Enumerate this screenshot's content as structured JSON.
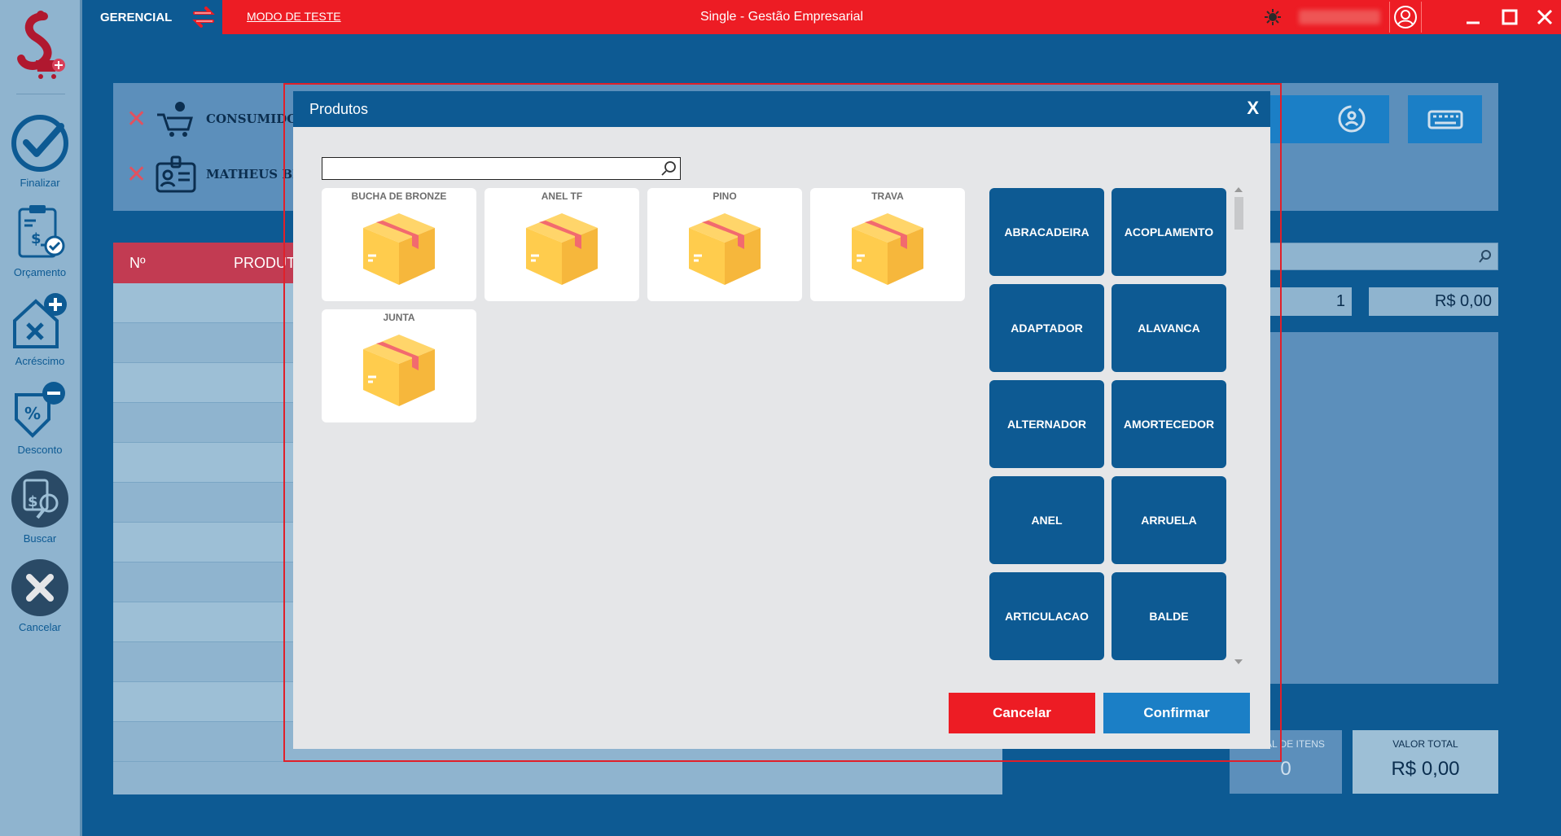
{
  "topbar": {
    "gerencial": "GERENCIAL",
    "modo_teste": "MODO DE TESTE",
    "title": "Single - Gestão Empresarial"
  },
  "sidebar": {
    "items": [
      {
        "label": "Finalizar",
        "icon": "check-circle-icon"
      },
      {
        "label": "Orçamento",
        "icon": "clipboard-money-icon"
      },
      {
        "label": "Acréscimo",
        "icon": "house-plus-icon"
      },
      {
        "label": "Desconto",
        "icon": "tag-minus-icon"
      },
      {
        "label": "Buscar",
        "icon": "calculator-search-icon"
      },
      {
        "label": "Cancelar",
        "icon": "x-circle-icon"
      }
    ]
  },
  "main": {
    "customer": "CONSUMIDOR",
    "seller": "MATHEUS BR",
    "table_headers": {
      "num": "Nº",
      "product": "PRODUT"
    },
    "quantity": "1",
    "price": "R$ 0,00",
    "total_items_label": "TOTAL DE ITENS",
    "total_items_value": "0",
    "total_value_label": "VALOR TOTAL",
    "total_value": "R$ 0,00"
  },
  "modal": {
    "title": "Produtos",
    "close": "X",
    "search_placeholder": "",
    "products": [
      {
        "name": "BUCHA DE BRONZE"
      },
      {
        "name": "ANEL TF"
      },
      {
        "name": "PINO"
      },
      {
        "name": "TRAVA"
      },
      {
        "name": "JUNTA"
      }
    ],
    "categories": [
      "ABRACADEIRA",
      "ACOPLAMENTO",
      "ADAPTADOR",
      "ALAVANCA",
      "ALTERNADOR",
      "AMORTECEDOR",
      "ANEL",
      "ARRUELA",
      "ARTICULACAO",
      "BALDE"
    ],
    "cancel": "Cancelar",
    "confirm": "Confirmar"
  },
  "colors": {
    "brand_blue": "#0d5a93",
    "brand_red": "#ed1c24",
    "confirm_blue": "#1b7fc6"
  }
}
